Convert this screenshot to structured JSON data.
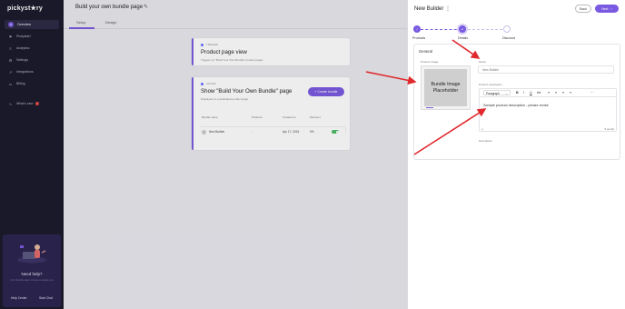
{
  "sidebar": {
    "logo": "pickyst★ry",
    "items": [
      {
        "label": "Overview",
        "icon": "P",
        "active": true
      },
      {
        "label": "Pickystart",
        "icon": "⚑"
      },
      {
        "label": "Analytics",
        "icon": "≡"
      },
      {
        "label": "Settings",
        "icon": "⚙"
      },
      {
        "label": "Integrations",
        "icon": "↗"
      },
      {
        "label": "Billing",
        "icon": "▭"
      },
      {
        "label": "What's new",
        "icon": "∿",
        "badge": true
      }
    ],
    "help": {
      "title": "Need help?",
      "subtitle": "Our friendly team is here to assist you",
      "help_center": "Help Center",
      "start_chat": "Start Chat"
    }
  },
  "main": {
    "title": "Build your own bundle page",
    "tabs": [
      {
        "label": "Setup",
        "active": true
      },
      {
        "label": "Design"
      }
    ],
    "trigger_card": {
      "tag": "TRIGGER",
      "title": "Product page view",
      "subtitle": "Triggers on \"Build Your Own Bundle\" product pages"
    },
    "action_card": {
      "tag": "ACTION",
      "title": "Show \"Build Your Own Bundle\" page",
      "subtitle": "Displayed on a dedicated product page",
      "create_button": "+ Create bundle",
      "columns": [
        "Bundle name",
        "Products",
        "Created on",
        "Discount"
      ],
      "row": {
        "name": "New Builder",
        "products": "-",
        "created": "Apr 17, 2024",
        "discount": "0%",
        "enabled": true
      }
    }
  },
  "panel": {
    "title": "New Builder",
    "back_label": "Back",
    "next_label": "Next",
    "steps": [
      {
        "label": "Products",
        "state": "done"
      },
      {
        "label": "Details",
        "state": "active"
      },
      {
        "label": "Discount",
        "state": "pending"
      }
    ],
    "general": {
      "section_title": "General",
      "image_label": "Product image",
      "image_placeholder": "Bundle Image Placeholder",
      "name_label": "Name",
      "name_value": "New Builder",
      "desc_label": "Product description",
      "paragraph_select": "Paragraph",
      "desc_text": "Sample product description - please revise",
      "footer_p": "p",
      "word_count": "5 words",
      "desc_caption": "Description"
    }
  },
  "colors": {
    "accent": "#7a5ae0",
    "sidebar": "#1b1a2b",
    "arrow": "#e0282d"
  }
}
